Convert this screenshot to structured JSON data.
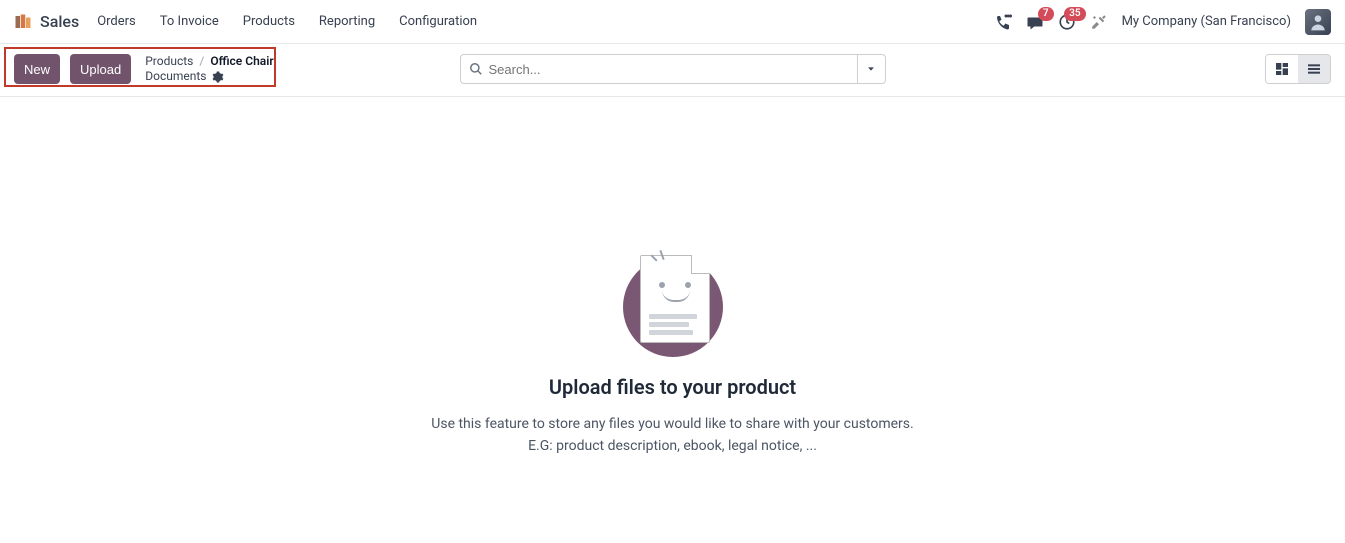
{
  "app_name": "Sales",
  "nav": [
    "Orders",
    "To Invoice",
    "Products",
    "Reporting",
    "Configuration"
  ],
  "header": {
    "messages_badge": "7",
    "activities_badge": "35",
    "company": "My Company (San Francisco)"
  },
  "actions": {
    "new": "New",
    "upload": "Upload"
  },
  "breadcrumb": {
    "parent": "Products",
    "current": "Office Chair",
    "sub": "Documents"
  },
  "search": {
    "placeholder": "Search..."
  },
  "empty": {
    "title": "Upload files to your product",
    "line1": "Use this feature to store any files you would like to share with your customers.",
    "line2": "E.G: product description, ebook, legal notice, ..."
  }
}
